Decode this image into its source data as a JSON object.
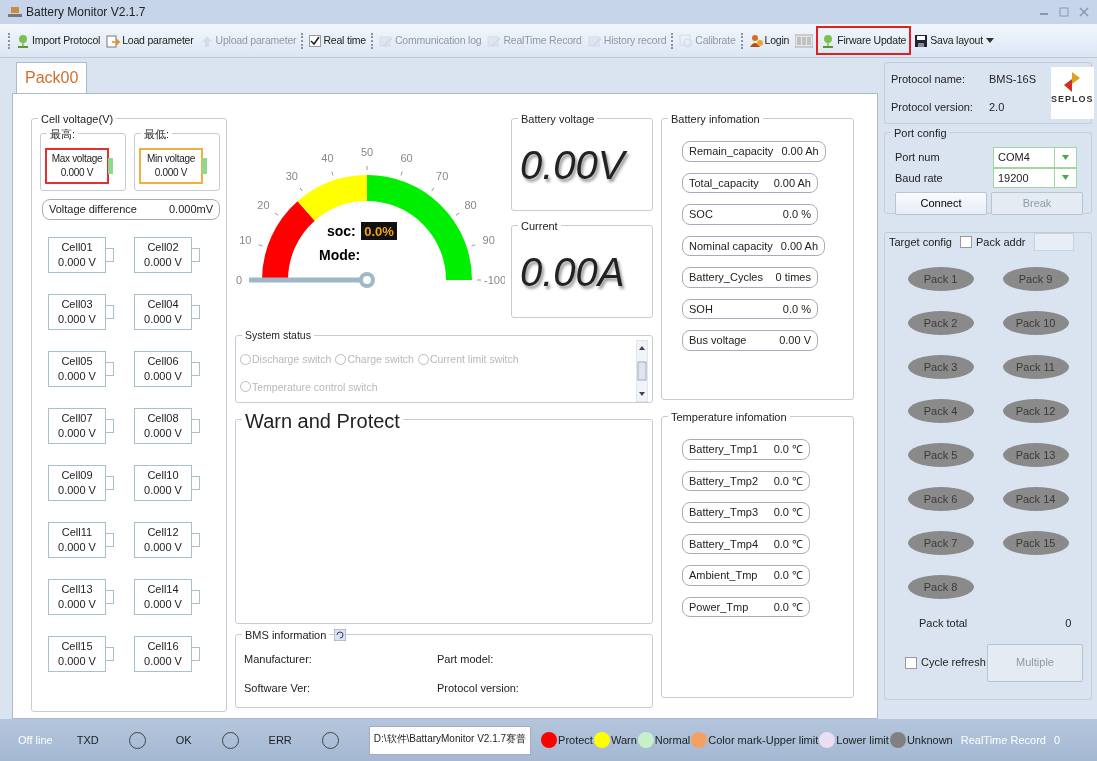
{
  "window": {
    "title": "Battery Monitor V2.1.7"
  },
  "toolbar": [
    {
      "label": "Import Protocol",
      "kind": "button",
      "disabled": false,
      "grip": true,
      "highlighted": false
    },
    {
      "label": "Load parameter",
      "kind": "button",
      "disabled": false,
      "grip": false,
      "highlighted": false
    },
    {
      "label": "Upload parameter",
      "kind": "button",
      "disabled": true,
      "grip": false,
      "highlighted": false
    },
    {
      "label": "Real time",
      "kind": "check",
      "checked": true,
      "disabled": false,
      "grip": true,
      "highlighted": false
    },
    {
      "label": "Communication log",
      "kind": "button",
      "disabled": true,
      "grip": true,
      "highlighted": false
    },
    {
      "label": "RealTime Record",
      "kind": "button",
      "disabled": true,
      "grip": false,
      "highlighted": false
    },
    {
      "label": "History record",
      "kind": "button",
      "disabled": true,
      "grip": false,
      "highlighted": false
    },
    {
      "label": "Calibrate",
      "kind": "button",
      "disabled": true,
      "grip": true,
      "highlighted": false
    },
    {
      "label": "Login",
      "kind": "button",
      "disabled": false,
      "grip": true,
      "highlighted": false
    },
    {
      "kind": "icon",
      "disabled": false,
      "grip": false,
      "highlighted": false
    },
    {
      "label": "Firware Update",
      "kind": "button",
      "disabled": false,
      "grip": false,
      "highlighted": true
    },
    {
      "label": "Sava layout",
      "kind": "button",
      "disabled": false,
      "grip": false,
      "highlighted": false
    }
  ],
  "tabs": [
    {
      "label": "Pack00",
      "selected": true
    }
  ],
  "cell_voltage": {
    "title": "Cell voltage(V)",
    "extremes": [
      {
        "title": "最高:",
        "label": "Max voltage",
        "value": "0.000 V",
        "color": "#e03030"
      },
      {
        "title": "最低:",
        "label": "Min voltage",
        "value": "0.000 V",
        "color": "#f0b040"
      }
    ],
    "difference": {
      "label": "Voltage difference",
      "value": "0.000mV"
    },
    "cells": [
      {
        "name": "Cell01",
        "value": "0.000 V"
      },
      {
        "name": "Cell02",
        "value": "0.000 V"
      },
      {
        "name": "Cell03",
        "value": "0.000 V"
      },
      {
        "name": "Cell04",
        "value": "0.000 V"
      },
      {
        "name": "Cell05",
        "value": "0.000 V"
      },
      {
        "name": "Cell06",
        "value": "0.000 V"
      },
      {
        "name": "Cell07",
        "value": "0.000 V"
      },
      {
        "name": "Cell08",
        "value": "0.000 V"
      },
      {
        "name": "Cell09",
        "value": "0.000 V"
      },
      {
        "name": "Cell10",
        "value": "0.000 V"
      },
      {
        "name": "Cell11",
        "value": "0.000 V"
      },
      {
        "name": "Cell12",
        "value": "0.000 V"
      },
      {
        "name": "Cell13",
        "value": "0.000 V"
      },
      {
        "name": "Cell14",
        "value": "0.000 V"
      },
      {
        "name": "Cell15",
        "value": "0.000 V"
      },
      {
        "name": "Cell16",
        "value": "0.000 V"
      }
    ]
  },
  "gauge": {
    "ticks": [
      "0",
      "10",
      "20",
      "30",
      "40",
      "50",
      "60",
      "70",
      "80",
      "90",
      "-100"
    ],
    "zones": [
      {
        "color": "#ff0000"
      },
      {
        "color": "#ffff00"
      },
      {
        "color": "#00ee00"
      }
    ],
    "soc_label": "soc:",
    "soc_value": "0.0%",
    "mode_label": "Mode:",
    "level": 0
  },
  "battery_voltage": {
    "title": "Battery voltage",
    "value": "0.00V"
  },
  "current": {
    "title": "Current",
    "value": "0.00A"
  },
  "system_status": {
    "title": "System status",
    "disabled": true,
    "options": [
      {
        "label": "Discharge switch",
        "checked": false
      },
      {
        "label": "Charge switch",
        "checked": false
      },
      {
        "label": "Current limit switch",
        "checked": false
      },
      {
        "label": "Temperature control switch",
        "checked": false
      }
    ]
  },
  "warn_protect": {
    "title": "Warn and Protect"
  },
  "bms_information": {
    "title": "BMS information",
    "fields": [
      {
        "label": "Manufacturer:"
      },
      {
        "label": "Part model:"
      },
      {
        "label": "Software Ver:"
      },
      {
        "label": "Protocol version:"
      }
    ]
  },
  "battery_information": {
    "title": "Battery infomation",
    "items": [
      {
        "label": "Remain_capacity",
        "value": "0.00 Ah"
      },
      {
        "label": "Total_capacity",
        "value": "0.00 Ah"
      },
      {
        "label": "SOC",
        "value": "0.0 %"
      },
      {
        "label": "Nominal capacity",
        "value": "0.00 Ah"
      },
      {
        "label": "Battery_Cycles",
        "value": "0 times"
      },
      {
        "label": "SOH",
        "value": "0.0 %"
      },
      {
        "label": "Bus voltage",
        "value": "0.00 V"
      }
    ]
  },
  "temperature_information": {
    "title": "Temperature infomation",
    "items": [
      {
        "label": "Battery_Tmp1",
        "value": "0.0 ℃"
      },
      {
        "label": "Battery_Tmp2",
        "value": "0.0 ℃"
      },
      {
        "label": "Battery_Tmp3",
        "value": "0.0 ℃"
      },
      {
        "label": "Battery_Tmp4",
        "value": "0.0 ℃"
      },
      {
        "label": "Ambient_Tmp",
        "value": "0.0 ℃"
      },
      {
        "label": "Power_Tmp",
        "value": "0.0 ℃"
      }
    ]
  },
  "protocol": {
    "name_label": "Protocol name:",
    "name": "BMS-16S",
    "version_label": "Protocol version:",
    "version": "2.0",
    "logo": "SEPLOS"
  },
  "port_config": {
    "title": "Port config",
    "port_label": "Port num",
    "port": "COM4",
    "baud_label": "Baud rate",
    "baud": "19200",
    "buttons": [
      {
        "label": "Connect",
        "disabled": false
      },
      {
        "label": "Break",
        "disabled": true
      }
    ]
  },
  "target_config": {
    "title": "Target config",
    "pack_addr": {
      "label": "Pack addr",
      "checked": false
    },
    "packs": [
      {
        "label": "Pack 1"
      },
      {
        "label": "Pack 2"
      },
      {
        "label": "Pack 3"
      },
      {
        "label": "Pack 4"
      },
      {
        "label": "Pack 5"
      },
      {
        "label": "Pack 6"
      },
      {
        "label": "Pack 7"
      },
      {
        "label": "Pack 8"
      },
      {
        "label": "Pack 9"
      },
      {
        "label": "Pack 10"
      },
      {
        "label": "Pack 11"
      },
      {
        "label": "Pack 12"
      },
      {
        "label": "Pack 13"
      },
      {
        "label": "Pack 14"
      },
      {
        "label": "Pack 15"
      }
    ],
    "pack_total_label": "Pack total",
    "pack_total": "0",
    "cycle_refresh": {
      "label": "Cycle refresh",
      "checked": false
    },
    "multiple": {
      "label": "Multiple",
      "disabled": true
    }
  },
  "status_bar": {
    "connection": "Off line",
    "indicators": [
      {
        "label": "TXD",
        "lit": false
      },
      {
        "label": "OK",
        "lit": false
      },
      {
        "label": "ERR",
        "lit": false
      }
    ],
    "path": "D:\\软件\\BattaryMonitor V2.1.7赛普",
    "legend": [
      {
        "label": "Protect",
        "color": "#ff0000"
      },
      {
        "label": "Warn",
        "color": "#ffff00"
      },
      {
        "label": "Normal",
        "color": "#c8f0c8"
      },
      {
        "label": "Color mark-Upper limit",
        "color": "#f4a060"
      },
      {
        "label": "Lower limit",
        "color": "#ecdcf4"
      },
      {
        "label": "Unknown",
        "color": "#808080"
      }
    ],
    "record_label": "RealTime Record",
    "record_count": "0"
  }
}
